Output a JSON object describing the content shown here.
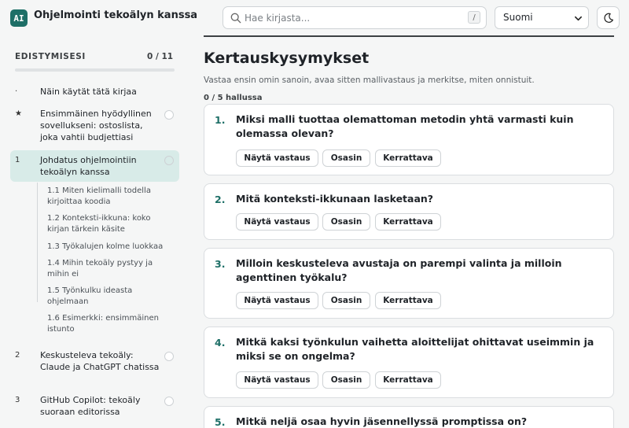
{
  "header": {
    "logo_text": "AI",
    "app_title": "Ohjelmointi tekoälyn kanssa",
    "search_placeholder": "Hae kirjasta...",
    "search_shortcut": "/",
    "language": "Suomi"
  },
  "sidebar": {
    "progress_title": "EDISTYMISESI",
    "progress_count": "0 / 11",
    "progress_fraction": 0,
    "items": [
      {
        "num": "·",
        "label": "Näin käytät tätä kirjaa"
      },
      {
        "num": "★",
        "label": "Ensimmäinen hyödyllinen sovellukseni: ostoslista, joka vahtii budjettiasi"
      },
      {
        "num": "1",
        "label": "Johdatus ohjelmointiin tekoälyn kanssa"
      },
      {
        "num": "2",
        "label": "Keskusteleva tekoäly: Claude ja ChatGPT chatissa"
      },
      {
        "num": "3",
        "label": "GitHub Copilot: tekoäly suoraan editorissa"
      }
    ],
    "subitems": [
      "1.1  Miten kielimalli todella kirjoittaa koodia",
      "1.2  Konteksti-ikkuna: koko kirjan tärkein käsite",
      "1.3  Työkalujen kolme luokkaa",
      "1.4  Mihin tekoäly pystyy ja mihin ei",
      "1.5  Työnkulku ideasta ohjelmaan",
      "1.6  Esimerkki: ensimmäinen istunto"
    ]
  },
  "main": {
    "title": "Kertauskysymykset",
    "intro": "Vastaa ensin omin sanoin, avaa sitten mallivastaus ja merkitse, miten onnistuit.",
    "mastered": "0 / 5 hallussa",
    "buttons": {
      "show": "Näytä vastaus",
      "know": "Osasin",
      "review": "Kerrattava"
    },
    "questions": [
      {
        "num": "1.",
        "text": "Miksi malli tuottaa olemattoman metodin yhtä varmasti kuin olemassa olevan?"
      },
      {
        "num": "2.",
        "text": "Mitä konteksti-ikkunaan lasketaan?"
      },
      {
        "num": "3.",
        "text": "Milloin keskusteleva avustaja on parempi valinta ja milloin agenttinen työkalu?"
      },
      {
        "num": "4.",
        "text": "Mitkä kaksi työnkulun vaihetta aloittelijat ohittavat useimmin ja miksi se on ongelma?"
      },
      {
        "num": "5.",
        "text": "Mitkä neljä osaa hyvin jäsennellyssä promptissa on?"
      }
    ]
  }
}
